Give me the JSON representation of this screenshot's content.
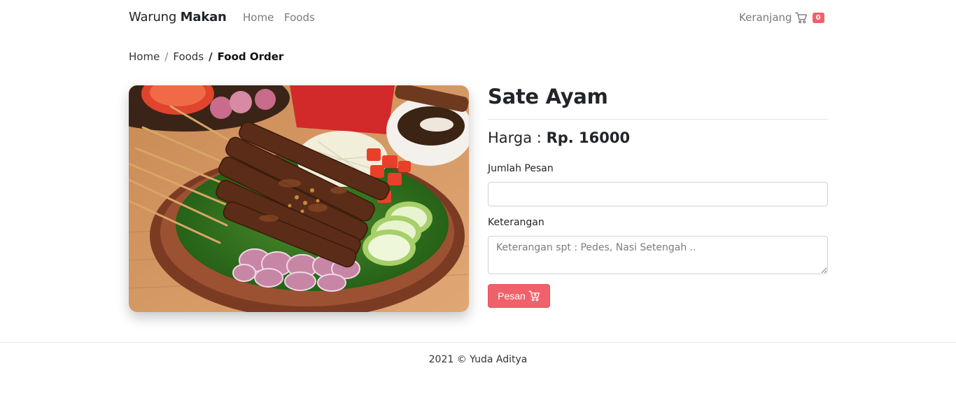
{
  "navbar": {
    "brand_regular": "Warung",
    "brand_bold": "Makan",
    "links": [
      "Home",
      "Foods"
    ],
    "cart_label": "Keranjang",
    "cart_icon": "cart-icon",
    "cart_count": "0",
    "badge_color": "#f0616b"
  },
  "breadcrumb": {
    "items": [
      "Home",
      "Foods"
    ],
    "active": "Food Order"
  },
  "food": {
    "name": "Sate Ayam",
    "price_label": "Harga :",
    "price_value": "Rp. 16000"
  },
  "form": {
    "qty_label": "Jumlah Pesan",
    "qty_value": "",
    "note_label": "Keterangan",
    "note_placeholder": "Keterangan spt : Pedes, Nasi Setengah ..",
    "submit_label": "Pesan",
    "submit_icon": "cart-icon",
    "accent": "#f0616b"
  },
  "footer": {
    "text": "2021 © Yuda Aditya"
  }
}
